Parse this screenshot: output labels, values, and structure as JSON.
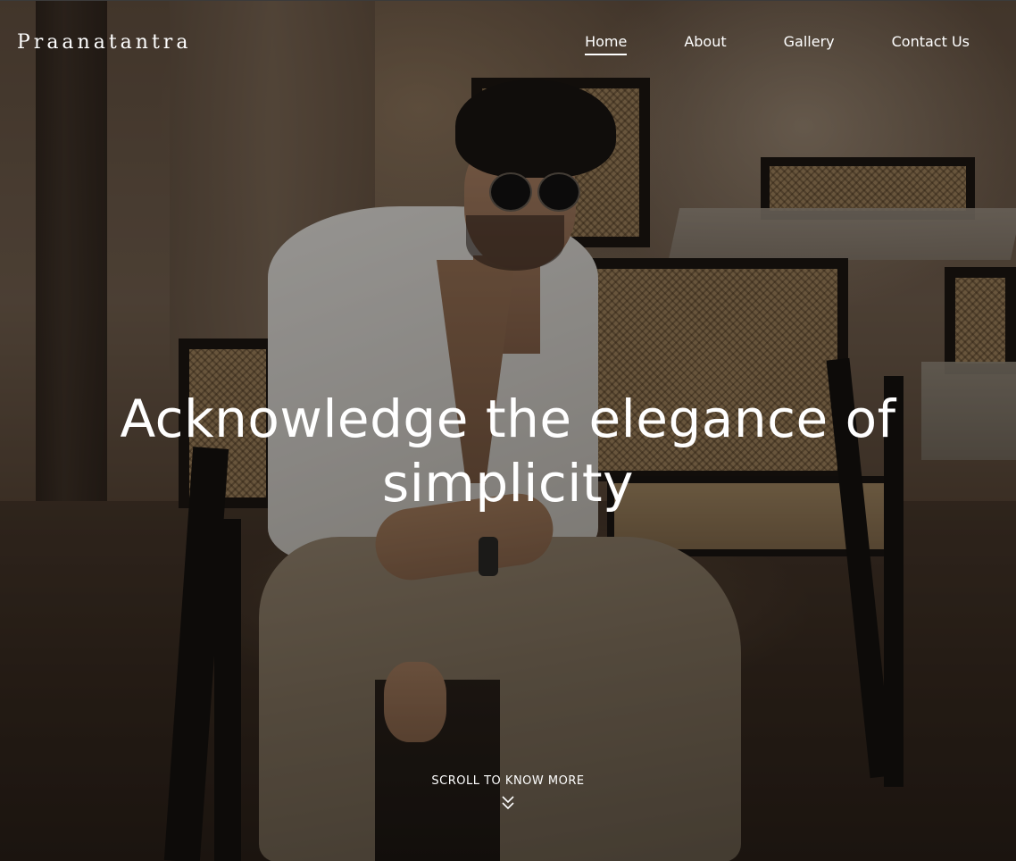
{
  "site": {
    "logo_text": "Praanatantra"
  },
  "nav": {
    "items": [
      {
        "label": "Home",
        "active": true
      },
      {
        "label": "About",
        "active": false
      },
      {
        "label": "Gallery",
        "active": false
      },
      {
        "label": "Contact Us",
        "active": false
      }
    ]
  },
  "hero": {
    "headline_line1": "Acknowledge the elegance of",
    "headline_line2": "simplicity",
    "scroll_cta": "SCROLL TO KNOW MORE",
    "scroll_icon": "double-chevron-down-icon"
  },
  "colors": {
    "text": "#ffffff",
    "overlay": "rgba(0,0,0,0.38)"
  }
}
